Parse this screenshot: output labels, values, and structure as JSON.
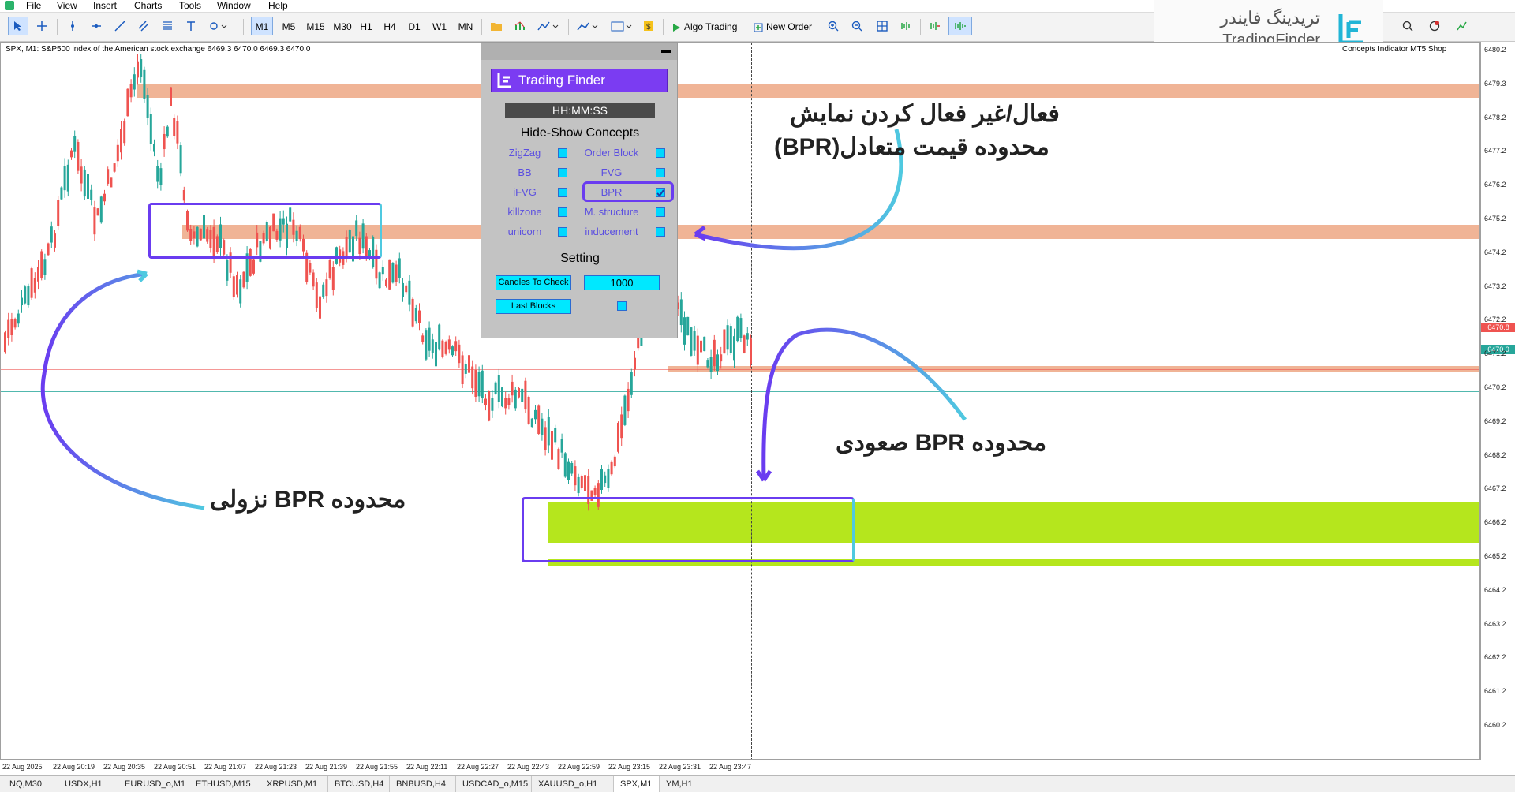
{
  "menu": [
    "File",
    "View",
    "Insert",
    "Charts",
    "Tools",
    "Window",
    "Help"
  ],
  "timeframes": [
    "M1",
    "M5",
    "M15",
    "M30",
    "H1",
    "H4",
    "D1",
    "W1",
    "MN"
  ],
  "active_timeframe": "M1",
  "toolbar": {
    "algo_trading": "Algo Trading",
    "new_order": "New Order"
  },
  "chart": {
    "header": "SPX, M1:  S&P500 index of the American stock exchange  6469.3 6470.0 6469.3 6470.0",
    "header_right": "Concepts Indicator MT5 Shop",
    "price_ticks": [
      "6480.2",
      "6479.3",
      "6478.2",
      "6477.2",
      "6476.2",
      "6475.2",
      "6474.2",
      "6473.2",
      "6472.2",
      "6471.2",
      "6470.2",
      "6469.2",
      "6468.2",
      "6467.2",
      "6466.2",
      "6465.2",
      "6464.2",
      "6463.2",
      "6462.2",
      "6461.2",
      "6460.2"
    ],
    "price_tag_red": "6470.8",
    "price_tag_blue": "6470.0",
    "time_ticks": [
      "22 Aug 2025",
      "22 Aug 20:19",
      "22 Aug 20:35",
      "22 Aug 20:51",
      "22 Aug 21:07",
      "22 Aug 21:23",
      "22 Aug 21:39",
      "22 Aug 21:55",
      "22 Aug 22:11",
      "22 Aug 22:27",
      "22 Aug 22:43",
      "22 Aug 22:59",
      "22 Aug 23:15",
      "22 Aug 23:31",
      "22 Aug 23:47"
    ],
    "colors": {
      "bull": "#26a69a",
      "bear": "#ef5350",
      "bearish_zone": "#f0b496",
      "bullish_zone": "#b5e61d"
    }
  },
  "panel": {
    "logo": "Trading Finder",
    "clock": "HH:MM:SS",
    "concepts_title": "Hide-Show Concepts",
    "concepts": [
      {
        "label": "ZigZag",
        "checked": false
      },
      {
        "label": "Order Block",
        "checked": false
      },
      {
        "label": "BB",
        "checked": false
      },
      {
        "label": "FVG",
        "checked": false
      },
      {
        "label": "iFVG",
        "checked": false
      },
      {
        "label": "BPR",
        "checked": true
      },
      {
        "label": "killzone",
        "checked": false
      },
      {
        "label": "M. structure",
        "checked": false
      },
      {
        "label": "unicorn",
        "checked": false
      },
      {
        "label": "inducement",
        "checked": false
      }
    ],
    "setting_title": "Setting",
    "candles_label": "Candles To Check",
    "candles_value": "1000",
    "last_blocks_label": "Last Blocks"
  },
  "annotations": {
    "toggle_line1": "فعال/غیر فعال کردن نمایش",
    "toggle_line2": "محدوده قیمت متعادل(BPR)",
    "bullish": "محدوده  BPR صعودی",
    "bearish": "محدوده  BPR نزولی"
  },
  "brand": {
    "fa": "تریدینگ فایندر",
    "en": "TradingFinder"
  },
  "tabs": [
    "NQ,M30",
    "USDX,H1",
    "EURUSD_o,M1",
    "ETHUSD,M15",
    "XRPUSD,M1",
    "BTCUSD,H4",
    "BNBUSD,H4",
    "USDCAD_o,M15",
    "XAUUSD_o,H1",
    "SPX,M1",
    "YM,H1"
  ],
  "active_tab": "SPX,M1"
}
